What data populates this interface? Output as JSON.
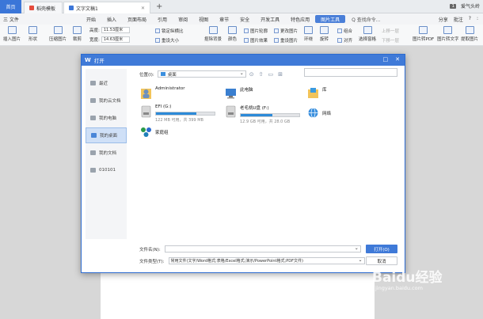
{
  "tabs": [
    {
      "label": "首页"
    },
    {
      "label": "稻壳模板"
    },
    {
      "label": "文字文稿1"
    }
  ],
  "titlebar_right": {
    "badge": "1",
    "user": "爱气头岭"
  },
  "menu": {
    "file": "三 文件",
    "items": [
      "开始",
      "插入",
      "页面布局",
      "引用",
      "审阅",
      "视图",
      "章节",
      "安全",
      "开发工具",
      "特色应用",
      "图片工具"
    ],
    "search": "Q 查找命令...",
    "right": [
      "分享",
      "批注",
      "?",
      ":"
    ]
  },
  "ribbon": {
    "insert_pic": "插入图片",
    "shape": "形状",
    "compress": "压缩图片",
    "crop": "裁剪",
    "height_label": "高度:",
    "height_val": "11.53厘米",
    "width_label": "宽度:",
    "width_val": "14.63厘米",
    "lock_ratio": "锁定纵横比",
    "reset_size": "重设大小",
    "cutout": "抠除背景",
    "color": "颜色",
    "pic_outline": "图片轮廓",
    "pic_effect": "图片效果",
    "change_pic": "更改图片",
    "reset_pic": "重设图片",
    "wrap": "环绕",
    "rotate": "旋转",
    "align": "对齐",
    "combine": "组合",
    "select_pane": "选择窗格",
    "up_layer": "上移一层",
    "down_layer": "下移一层",
    "to_pdf": "图片转PDF",
    "to_text": "图片转文字",
    "extract": "提取图片"
  },
  "dialog": {
    "title": "打开",
    "logo": "W",
    "location_label": "位置(I):",
    "location_value": "桌面",
    "sidebar": [
      {
        "label": "最近"
      },
      {
        "label": "我的云文档"
      },
      {
        "label": "我的电脑"
      },
      {
        "label": "我的桌面"
      },
      {
        "label": "我的文档"
      },
      {
        "label": "010101"
      }
    ],
    "items": {
      "admin": "Administrator",
      "thispc": "此电脑",
      "lib": "库",
      "efi_name": "EFI (G:)",
      "efi_cap": "122 MB 可用，共 399 MB",
      "usb_name": "老毛桃U盘 (F:)",
      "usb_cap": "12.9 GB 可用，共 28.0 GB",
      "network": "网络",
      "homegroup": "家庭组"
    },
    "efi_used": 0.69,
    "usb_used": 0.54,
    "filename_label": "文件名(N):",
    "filetype_label": "文件类型(T):",
    "filetype_value": "常用文件(文字/Word格式;表格/Excel格式;演示/PowerPoint格式;PDF文件)",
    "open_btn": "打开(O)",
    "cancel_btn": "取消"
  },
  "watermark": {
    "line1": "Baidu经验",
    "line2": "jingyan.baidu.com"
  }
}
